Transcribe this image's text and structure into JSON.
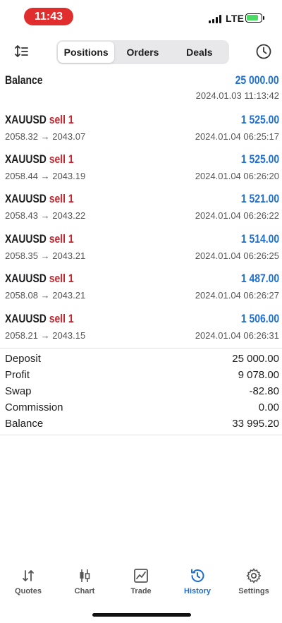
{
  "status_bar": {
    "time": "11:43",
    "network": "LTE"
  },
  "toolbar": {
    "segments": [
      "Positions",
      "Orders",
      "Deals"
    ],
    "active_segment": "Positions"
  },
  "balance_header": {
    "label": "Balance",
    "amount": "25 000.00",
    "datetime": "2024.01.03 11:13:42"
  },
  "trades": [
    {
      "symbol": "XAUUSD",
      "side": "sell 1",
      "prices": "2058.32 → 2043.07",
      "profit": "1 525.00",
      "datetime": "2024.01.04 06:25:17"
    },
    {
      "symbol": "XAUUSD",
      "side": "sell 1",
      "prices": "2058.44 → 2043.19",
      "profit": "1 525.00",
      "datetime": "2024.01.04 06:26:20"
    },
    {
      "symbol": "XAUUSD",
      "side": "sell 1",
      "prices": "2058.43 → 2043.22",
      "profit": "1 521.00",
      "datetime": "2024.01.04 06:26:22"
    },
    {
      "symbol": "XAUUSD",
      "side": "sell 1",
      "prices": "2058.35 → 2043.21",
      "profit": "1 514.00",
      "datetime": "2024.01.04 06:26:25"
    },
    {
      "symbol": "XAUUSD",
      "side": "sell 1",
      "prices": "2058.08 → 2043.21",
      "profit": "1 487.00",
      "datetime": "2024.01.04 06:26:27"
    },
    {
      "symbol": "XAUUSD",
      "side": "sell 1",
      "prices": "2058.21 → 2043.15",
      "profit": "1 506.00",
      "datetime": "2024.01.04 06:26:31"
    }
  ],
  "summary": [
    {
      "label": "Deposit",
      "value": "25 000.00"
    },
    {
      "label": "Profit",
      "value": "9 078.00"
    },
    {
      "label": "Swap",
      "value": "-82.80"
    },
    {
      "label": "Commission",
      "value": "0.00"
    },
    {
      "label": "Balance",
      "value": "33 995.20"
    }
  ],
  "tab_bar": {
    "tabs": [
      {
        "label": "Quotes",
        "icon": "quotes-icon"
      },
      {
        "label": "Chart",
        "icon": "candlestick-icon"
      },
      {
        "label": "Trade",
        "icon": "trade-icon"
      },
      {
        "label": "History",
        "icon": "history-icon"
      },
      {
        "label": "Settings",
        "icon": "gear-icon"
      }
    ],
    "active_tab": "History"
  },
  "colors": {
    "accent": "#1f6fcf",
    "sell": "#c8232c",
    "time_pill": "#e02d2d",
    "battery": "#4cd964"
  }
}
